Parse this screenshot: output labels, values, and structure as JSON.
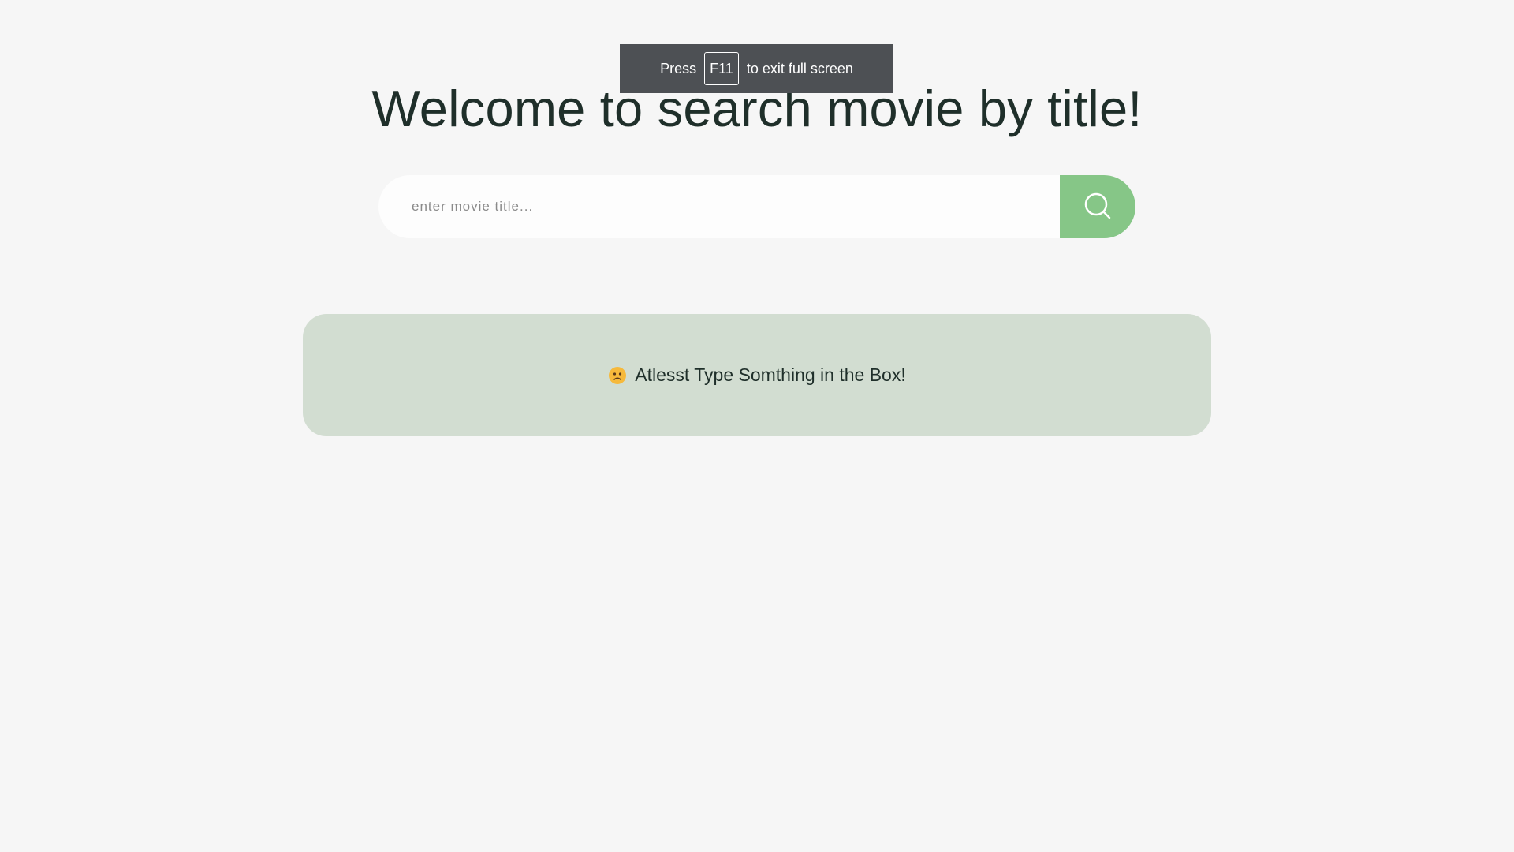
{
  "page": {
    "title": "Welcome to search movie by title!"
  },
  "search": {
    "placeholder": "enter movie title...",
    "value": "",
    "button_icon": "search-icon",
    "button_color": "#86c687"
  },
  "message": {
    "icon": "frowning-face-emoji",
    "text": "Atlesst Type Somthing in the Box!",
    "background": "#d2ddd1"
  },
  "fullscreen_toast": {
    "before": "Press",
    "key": "F11",
    "after": "to exit full screen"
  },
  "colors": {
    "background": "#f6f6f6",
    "text": "#1f2f2a",
    "toast_bg": "#4d5054"
  }
}
